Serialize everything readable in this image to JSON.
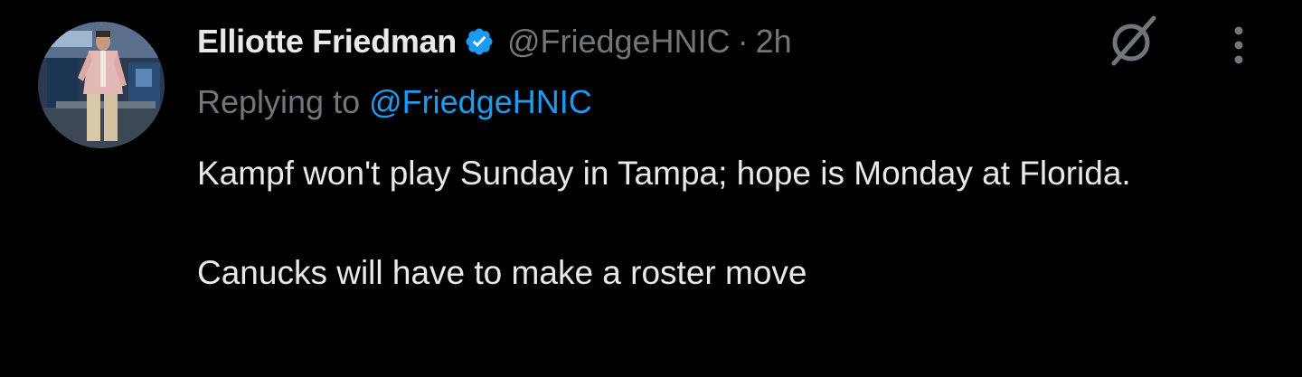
{
  "tweet": {
    "author": {
      "display_name": "Elliotte Friedman",
      "handle": "@FriedgeHNIC",
      "verified": true,
      "verified_color": "#1d9bf0"
    },
    "separator": "·",
    "timestamp": "2h",
    "reply": {
      "prefix": "Replying to",
      "mention": "@FriedgeHNIC"
    },
    "body": {
      "paragraph_1": "Kampf won't play Sunday in Tampa; hope is Monday at Florida.",
      "paragraph_2": "Canucks will have to make a roster move"
    },
    "icons": {
      "grok": "grok-icon",
      "more": "more-options-icon",
      "verified": "verified-badge-icon",
      "avatar": "profile-avatar"
    }
  },
  "colors": {
    "background": "#000000",
    "primary_text": "#e7e9ea",
    "secondary_text": "#71767b",
    "link": "#1d9bf0"
  }
}
